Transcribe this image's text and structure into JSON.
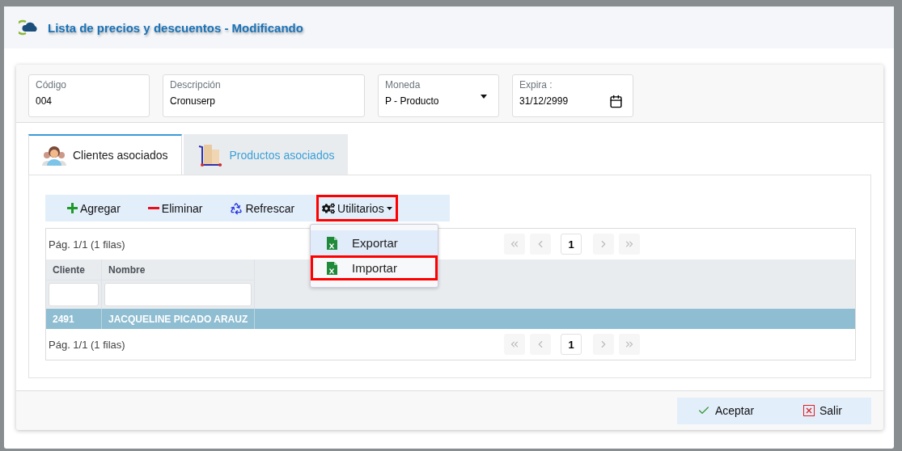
{
  "window": {
    "title": "Lista de precios y descuentos - Modificando"
  },
  "fields": [
    {
      "kind": "text",
      "label": "Código",
      "value": "004"
    },
    {
      "kind": "text",
      "label": "Descripción",
      "value": "Cronuserp"
    },
    {
      "kind": "select",
      "label": "Moneda",
      "value": "P - Producto"
    },
    {
      "kind": "date",
      "label": "Expira :",
      "value": "31/12/2999"
    }
  ],
  "tabs": [
    {
      "kind": "clients",
      "label": "Clientes asociados",
      "selected": true
    },
    {
      "kind": "products",
      "label": "Productos asociados",
      "selected": false
    }
  ],
  "toolbar": [
    {
      "kind": "add",
      "label": "Agregar",
      "highlighted": false
    },
    {
      "kind": "remove",
      "label": "Eliminar",
      "highlighted": false
    },
    {
      "kind": "refresh",
      "label": "Refrescar",
      "highlighted": false
    },
    {
      "kind": "menu",
      "label": "Utilitarios",
      "highlighted": true
    }
  ],
  "menu": {
    "items": [
      {
        "label": "Exportar",
        "hovered": true,
        "highlighted": false
      },
      {
        "label": "Importar",
        "hovered": false,
        "highlighted": true
      }
    ]
  },
  "grid": {
    "top_pager": {
      "info": "Pág. 1/1 (1 filas)",
      "page": "1"
    },
    "columns": [
      "Cliente",
      "Nombre"
    ],
    "rows": [
      {
        "cells": [
          "2491",
          "JACQUELINE PICADO ARAUZ"
        ],
        "selected": true
      }
    ],
    "bottom_pager": {
      "info": "Pág. 1/1 (1 filas)",
      "page": "1"
    }
  },
  "footer": {
    "buttons": [
      {
        "kind": "accept",
        "label": "Aceptar"
      },
      {
        "kind": "exit",
        "label": "Salir"
      }
    ]
  }
}
